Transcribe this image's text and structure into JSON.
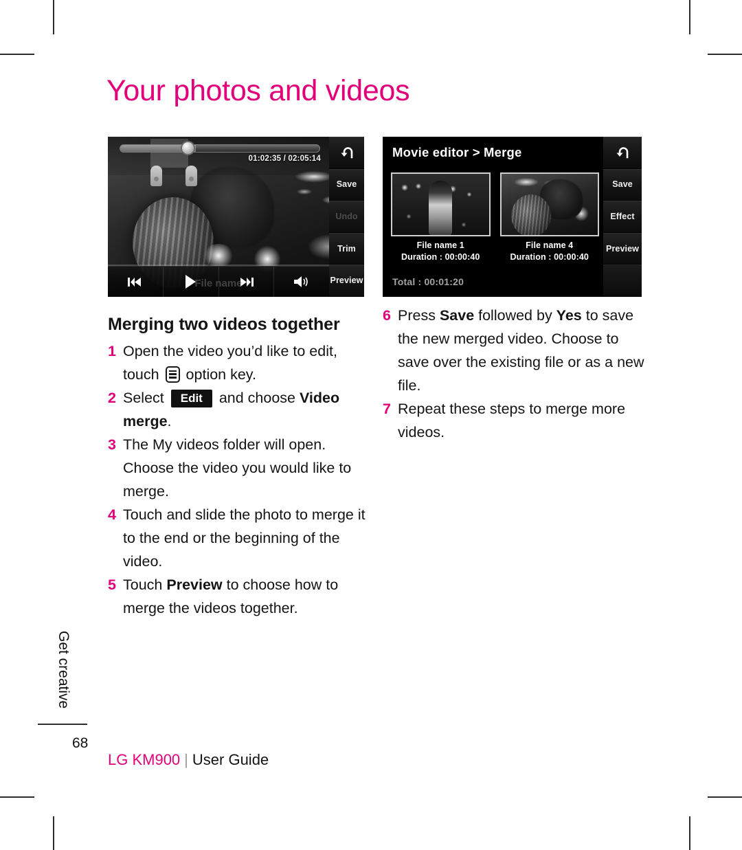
{
  "page": {
    "title": "Your photos and videos",
    "number": "68",
    "side_tab": "Get creative",
    "footer": {
      "brand": "LG KM900",
      "separator": "|",
      "guide": "User Guide"
    },
    "accent_color": "#e2007a"
  },
  "screenshot_1": {
    "timecode": "01:02:35 / 02:05:14",
    "ghost_filename": "File name",
    "transport": [
      "prev-track-icon",
      "play-icon",
      "next-track-icon",
      "volume-icon"
    ],
    "sidebar": [
      {
        "label": "",
        "icon": "back-arrow-icon",
        "disabled": false
      },
      {
        "label": "Save",
        "icon": "",
        "disabled": false
      },
      {
        "label": "Undo",
        "icon": "",
        "disabled": true
      },
      {
        "label": "Trim",
        "icon": "",
        "disabled": false
      },
      {
        "label": "Preview",
        "icon": "",
        "disabled": false
      }
    ]
  },
  "screenshot_2": {
    "title": "Movie editor > Merge",
    "clips": [
      {
        "name": "File name 1",
        "duration": "Duration : 00:00:40"
      },
      {
        "name": "File name 4",
        "duration": "Duration : 00:00:40"
      }
    ],
    "total": "Total : 00:01:20",
    "sidebar": [
      {
        "label": "",
        "icon": "back-arrow-icon",
        "disabled": false
      },
      {
        "label": "Save",
        "icon": "",
        "disabled": false
      },
      {
        "label": "Effect",
        "icon": "",
        "disabled": false
      },
      {
        "label": "Preview",
        "icon": "",
        "disabled": false
      },
      {
        "label": "",
        "icon": "",
        "disabled": false
      }
    ]
  },
  "left_column": {
    "heading": "Merging two videos together",
    "steps": [
      {
        "num": "1",
        "prefix": "Open the video you’d like to edit, touch ",
        "icon": "option-key-icon",
        "suffix": " option key."
      },
      {
        "num": "2",
        "prefix": "Select ",
        "badge": "Edit",
        "mid": " and choose ",
        "bold": "Video merge",
        "suffix": "."
      },
      {
        "num": "3",
        "text": "The My videos folder will open. Choose the video you would like to merge."
      },
      {
        "num": "4",
        "text": "Touch and slide the photo to merge it to the end or the beginning of the video."
      },
      {
        "num": "5",
        "prefix": "Touch ",
        "bold": "Preview",
        "suffix": " to choose how to merge the videos together."
      }
    ]
  },
  "right_column": {
    "steps": [
      {
        "num": "6",
        "prefix": "Press ",
        "bold1": "Save",
        "mid": " followed by ",
        "bold2": "Yes",
        "suffix": " to save the new merged video. Choose to save over the existing file or as a new file."
      },
      {
        "num": "7",
        "text": "Repeat these steps to merge more videos."
      }
    ]
  }
}
